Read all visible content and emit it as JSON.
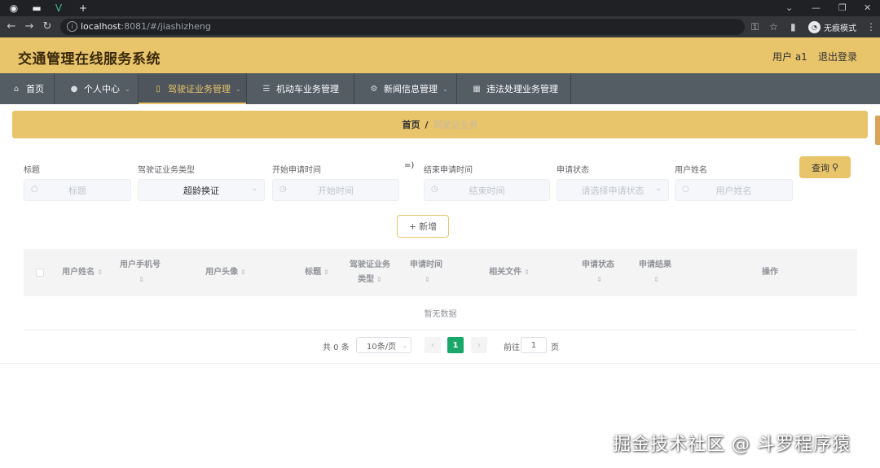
{
  "browser": {
    "url_host": "localhost",
    "url_rest": ":8081/#/jiashizheng",
    "incognito_label": "无痕模式"
  },
  "header": {
    "title": "交通管理在线服务系统",
    "user": "用户 a1",
    "logout": "退出登录"
  },
  "menu": [
    {
      "label": "首页",
      "icon": "home-icon"
    },
    {
      "label": "个人中心",
      "icon": "user-icon",
      "arrow": true
    },
    {
      "label": "驾驶证业务管理",
      "icon": "phone-icon",
      "arrow": true,
      "active": true
    },
    {
      "label": "机动车业务管理",
      "icon": "menu-icon"
    },
    {
      "label": "新闻信息管理",
      "icon": "gear-icon",
      "arrow": true
    },
    {
      "label": "违法处理业务管理",
      "icon": "grid-icon"
    }
  ],
  "breadcrumb": {
    "home": "首页",
    "separator": "/",
    "current": "驾驶证业务"
  },
  "form": {
    "title_label": "标题",
    "title_placeholder": "标题",
    "type_label": "驾驶证业务类型",
    "type_value": "超龄换证",
    "start_label": "开始申请时间",
    "start_placeholder": "开始时间",
    "range_separator": "=)",
    "end_label": "结束申请时间",
    "end_placeholder": "结束时间",
    "status_label": "申请状态",
    "status_placeholder": "请选择申请状态",
    "username_label": "用户姓名",
    "username_placeholder": "用户姓名",
    "query_button": "查询",
    "add_button": "新增"
  },
  "table": {
    "columns": [
      {
        "line1": "用户姓名",
        "line2": ""
      },
      {
        "line1": "用户手机号",
        "line2": ""
      },
      {
        "line1": "用户头像",
        "line2": ""
      },
      {
        "line1": "标题",
        "line2": ""
      },
      {
        "line1": "驾驶证业务",
        "line2": "类型"
      },
      {
        "line1": "申请时间",
        "line2": ""
      },
      {
        "line1": "相关文件",
        "line2": ""
      },
      {
        "line1": "申请状态",
        "line2": ""
      },
      {
        "line1": "申请结果",
        "line2": ""
      },
      {
        "line1": "操作",
        "line2": ""
      }
    ],
    "empty_text": "暂无数据"
  },
  "pagination": {
    "total": "共 0 条",
    "page_size": "10条/页",
    "current_page": "1",
    "goto_label": "前往",
    "goto_value": "1",
    "page_suffix": "页"
  },
  "watermark": "掘金技术社区 @ 斗罗程序猿",
  "colors": {
    "accent": "#e8c46a",
    "menu_bg": "#545c64",
    "page_active": "#1aa86a"
  }
}
